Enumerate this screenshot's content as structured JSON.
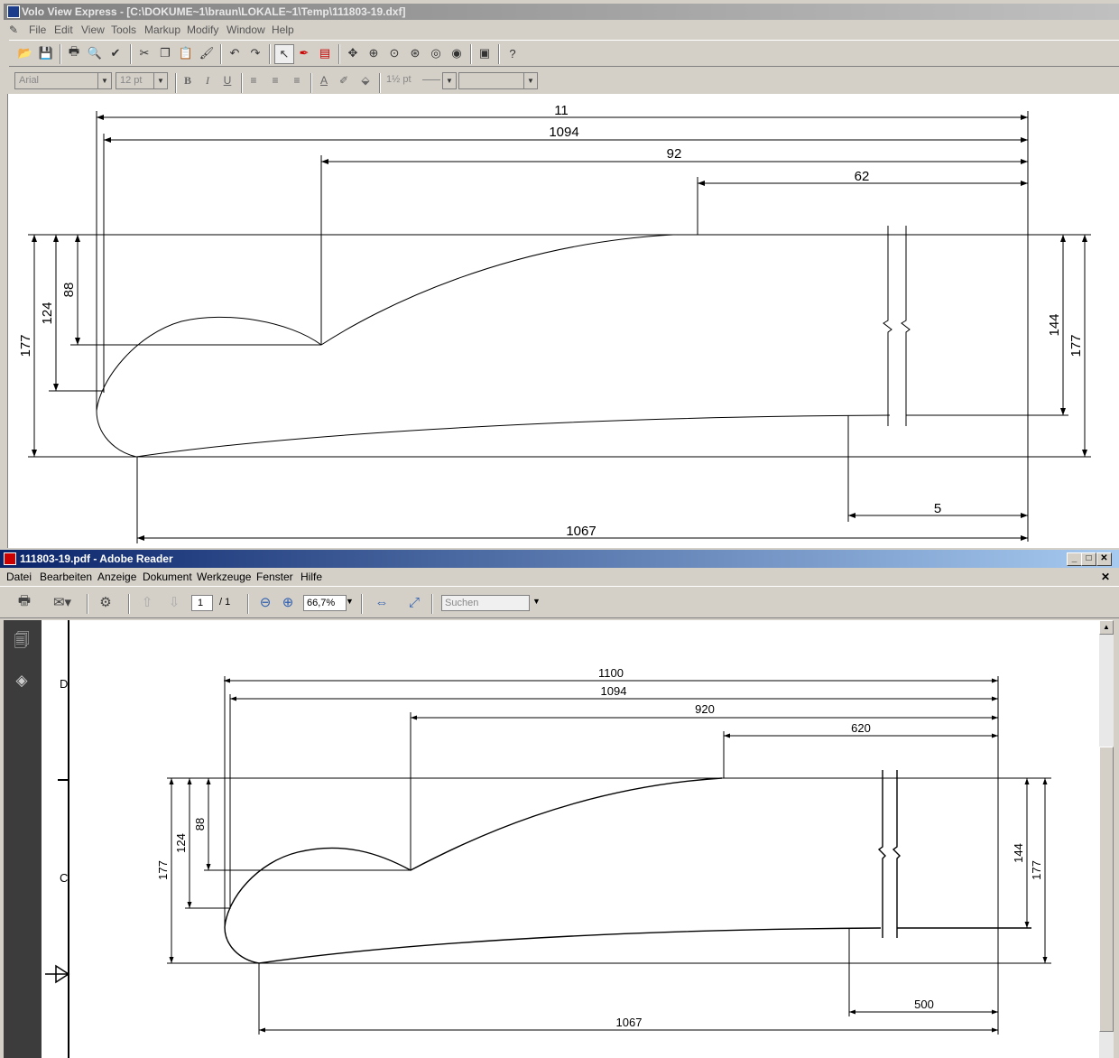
{
  "volo": {
    "title": "Volo View Express - [C:\\DOKUME~1\\braun\\LOKALE~1\\Temp\\111803-19.dxf]",
    "menu": [
      "File",
      "Edit",
      "View",
      "Tools",
      "Markup",
      "Modify",
      "Window",
      "Help"
    ],
    "font_name": "Arial",
    "font_size": "12 pt",
    "line_weight": "1½ pt",
    "dims": {
      "top_overall": "11",
      "second": "1094",
      "third": "92",
      "fourth": "62",
      "left_177": "177",
      "left_124": "124",
      "left_88": "88",
      "right_144": "144",
      "right_177": "177",
      "bottom_5": "5",
      "bottom_1067": "1067"
    }
  },
  "reader": {
    "title": "111803-19.pdf - Adobe Reader",
    "menu": [
      "Datei",
      "Bearbeiten",
      "Anzeige",
      "Dokument",
      "Werkzeuge",
      "Fenster",
      "Hilfe"
    ],
    "page_current": "1",
    "page_total": "/ 1",
    "zoom": "66,7%",
    "search_placeholder": "Suchen",
    "border_marks": [
      "D",
      "C"
    ],
    "dims": {
      "top_overall": "1100",
      "second": "1094",
      "third": "920",
      "fourth": "620",
      "left_177": "177",
      "left_124": "124",
      "left_88": "88",
      "right_144": "144",
      "right_177": "177",
      "bottom_500": "500",
      "bottom_1067": "1067"
    }
  },
  "colors": {
    "volo_title_gradient": [
      "#808080",
      "#c0c0c0"
    ],
    "reader_title_gradient": [
      "#0a246a",
      "#a6caf0"
    ],
    "chrome": "#d4d0c8",
    "reader_sidebar": "#3c3c3c"
  },
  "icons": {
    "volo_toolbar": [
      "open-icon",
      "save-icon",
      "print-icon",
      "print-preview-icon",
      "spell-check-icon",
      "cut-icon",
      "copy-icon",
      "paste-icon",
      "format-painter-icon",
      "undo-icon",
      "redo-icon",
      "select-arrow-icon",
      "markup-pen-icon",
      "text-box-icon",
      "pan-icon",
      "zoom-realtime-icon",
      "zoom-window-icon",
      "zoom-in-icon",
      "zoom-previous-icon",
      "zoom-extents-icon",
      "properties-icon",
      "whats-this-help-icon"
    ],
    "reader_toolbar": [
      "print-icon",
      "email-icon",
      "search-collab-icon",
      "previous-page-icon",
      "next-page-icon",
      "zoom-out-icon",
      "zoom-in-icon",
      "fit-width-icon",
      "fit-page-icon"
    ]
  }
}
